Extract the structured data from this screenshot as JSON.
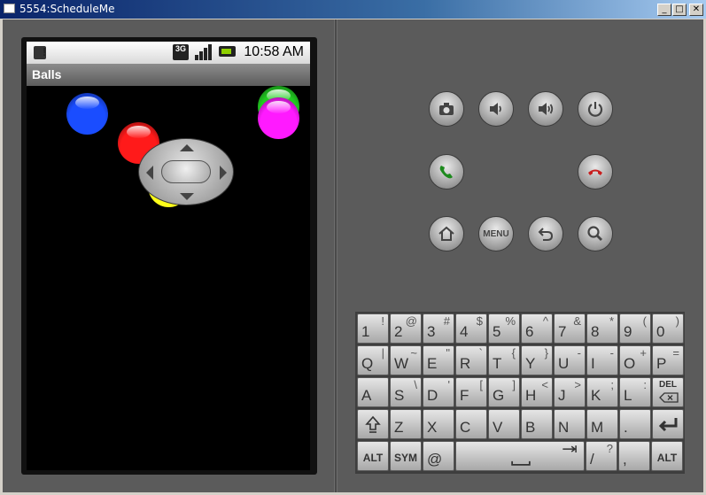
{
  "window": {
    "title": "5554:ScheduleMe",
    "buttons": {
      "minimize": "_",
      "maximize": "□",
      "close": "✕"
    }
  },
  "device": {
    "status_bar": {
      "network": "3G",
      "time": "10:58 AM"
    },
    "app_title": "Balls",
    "balls": [
      {
        "color": "#1a4dff"
      },
      {
        "color": "#ff1a1a"
      },
      {
        "color": "#ffff1a"
      },
      {
        "color": "#22cc22"
      },
      {
        "color": "#ff1aff"
      }
    ]
  },
  "controls": {
    "camera": "camera-icon",
    "volume_down": "volume-down-icon",
    "volume_up": "volume-up-icon",
    "power": "power-icon",
    "call": "call-icon",
    "end_call": "end-call-icon",
    "home": "home-icon",
    "menu_label": "MENU",
    "back": "back-icon",
    "search": "search-icon"
  },
  "keyboard": {
    "rows": [
      [
        {
          "m": "1",
          "a": "!"
        },
        {
          "m": "2",
          "a": "@"
        },
        {
          "m": "3",
          "a": "#"
        },
        {
          "m": "4",
          "a": "$"
        },
        {
          "m": "5",
          "a": "%"
        },
        {
          "m": "6",
          "a": "^"
        },
        {
          "m": "7",
          "a": "&"
        },
        {
          "m": "8",
          "a": "*"
        },
        {
          "m": "9",
          "a": "("
        },
        {
          "m": "0",
          "a": ")"
        }
      ],
      [
        {
          "m": "Q",
          "a": "|"
        },
        {
          "m": "W",
          "a": "~"
        },
        {
          "m": "E",
          "a": "\""
        },
        {
          "m": "R",
          "a": "`"
        },
        {
          "m": "T",
          "a": "{"
        },
        {
          "m": "Y",
          "a": "}"
        },
        {
          "m": "U",
          "a": "-"
        },
        {
          "m": "I",
          "a": "-"
        },
        {
          "m": "O",
          "a": "+"
        },
        {
          "m": "P",
          "a": "="
        }
      ],
      [
        {
          "m": "A",
          "a": ""
        },
        {
          "m": "S",
          "a": "\\"
        },
        {
          "m": "D",
          "a": "'"
        },
        {
          "m": "F",
          "a": "["
        },
        {
          "m": "G",
          "a": "]"
        },
        {
          "m": "H",
          "a": "<"
        },
        {
          "m": "J",
          "a": ">"
        },
        {
          "m": "K",
          "a": ";"
        },
        {
          "m": "L",
          "a": ":"
        },
        {
          "m": "DEL",
          "a": ""
        }
      ],
      [
        {
          "m": "shift-icon",
          "a": ""
        },
        {
          "m": "Z",
          "a": ""
        },
        {
          "m": "X",
          "a": ""
        },
        {
          "m": "C",
          "a": ""
        },
        {
          "m": "V",
          "a": ""
        },
        {
          "m": "B",
          "a": ""
        },
        {
          "m": "N",
          "a": ""
        },
        {
          "m": "M",
          "a": ""
        },
        {
          "m": ".",
          "a": ""
        },
        {
          "m": "enter-icon",
          "a": ""
        }
      ]
    ],
    "bottom": {
      "alt_left": "ALT",
      "sym": "SYM",
      "at": "@",
      "space": "space-icon",
      "slash": "/",
      "slash_alt": "?",
      "comma": ",",
      "alt_right": "ALT"
    }
  }
}
